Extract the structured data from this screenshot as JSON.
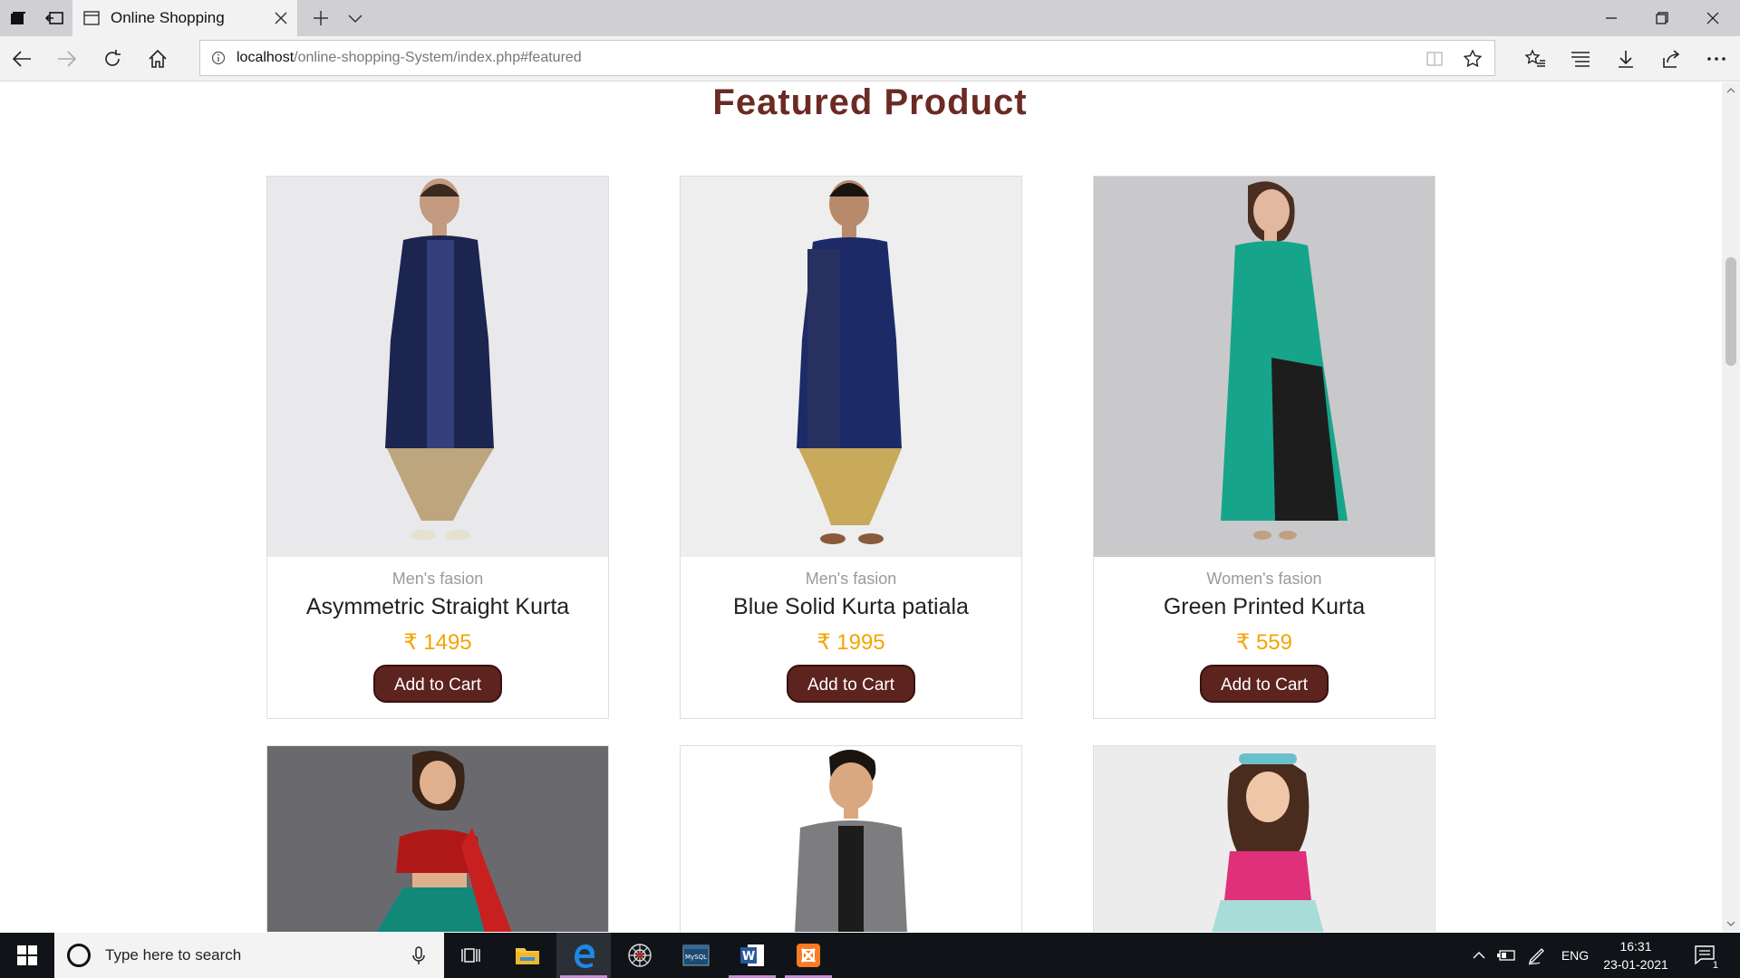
{
  "browser": {
    "tab_title": "Online Shopping",
    "url_host": "localhost",
    "url_path": "/online-shopping-System/index.php#featured"
  },
  "page": {
    "section_title": "Featured Product",
    "products": [
      {
        "category": "Men's fasion",
        "name": "Asymmetric Straight Kurta",
        "price": "₹ 1495",
        "button": "Add to Cart"
      },
      {
        "category": "Men's fasion",
        "name": "Blue Solid Kurta patiala",
        "price": "₹ 1995",
        "button": "Add to Cart"
      },
      {
        "category": "Women's fasion",
        "name": "Green Printed Kurta",
        "price": "₹ 559",
        "button": "Add to Cart"
      }
    ]
  },
  "taskbar": {
    "search_placeholder": "Type here to search",
    "language": "ENG",
    "time": "16:31",
    "date": "23-01-2021",
    "notification_count": "1"
  },
  "colors": {
    "title": "#6b2a24",
    "price": "#f6a300",
    "button": "#5c231f"
  }
}
